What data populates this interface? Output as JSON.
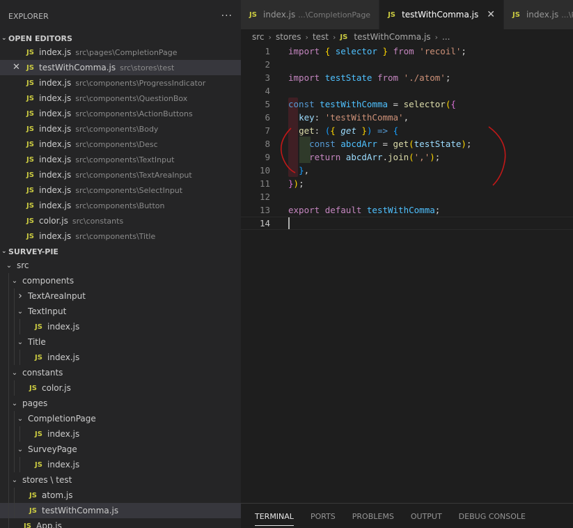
{
  "explorer": {
    "title": "EXPLORER",
    "more": "···"
  },
  "open_editors": {
    "title": "OPEN EDITORS",
    "items": [
      {
        "name": "index.js",
        "path": "src\\pages\\CompletionPage"
      },
      {
        "name": "testWithComma.js",
        "path": "src\\stores\\test",
        "active": true
      },
      {
        "name": "index.js",
        "path": "src\\components\\ProgressIndicator"
      },
      {
        "name": "index.js",
        "path": "src\\components\\QuestionBox"
      },
      {
        "name": "index.js",
        "path": "src\\components\\ActionButtons"
      },
      {
        "name": "index.js",
        "path": "src\\components\\Body"
      },
      {
        "name": "index.js",
        "path": "src\\components\\Desc"
      },
      {
        "name": "index.js",
        "path": "src\\components\\TextInput"
      },
      {
        "name": "index.js",
        "path": "src\\components\\TextAreaInput"
      },
      {
        "name": "index.js",
        "path": "src\\components\\SelectInput"
      },
      {
        "name": "index.js",
        "path": "src\\components\\Button"
      },
      {
        "name": "color.js",
        "path": "src\\constants"
      },
      {
        "name": "index.js",
        "path": "src\\components\\Title"
      }
    ]
  },
  "project": {
    "title": "SURVEY-PIE",
    "tree": [
      {
        "label": "src",
        "type": "folder",
        "level": 0
      },
      {
        "label": "components",
        "type": "folder",
        "level": 1
      },
      {
        "label": "TextAreaInput",
        "type": "folder-collapsed",
        "level": 2
      },
      {
        "label": "TextInput",
        "type": "folder",
        "level": 2
      },
      {
        "label": "index.js",
        "type": "file",
        "level": 3
      },
      {
        "label": "Title",
        "type": "folder",
        "level": 2
      },
      {
        "label": "index.js",
        "type": "file",
        "level": 3
      },
      {
        "label": "constants",
        "type": "folder",
        "level": 1
      },
      {
        "label": "color.js",
        "type": "file",
        "level": 2
      },
      {
        "label": "pages",
        "type": "folder",
        "level": 1
      },
      {
        "label": "CompletionPage",
        "type": "folder",
        "level": 2
      },
      {
        "label": "index.js",
        "type": "file",
        "level": 3
      },
      {
        "label": "SurveyPage",
        "type": "folder",
        "level": 2
      },
      {
        "label": "index.js",
        "type": "file",
        "level": 3
      },
      {
        "label": "stores \\ test",
        "type": "folder",
        "level": 1
      },
      {
        "label": "atom.js",
        "type": "file",
        "level": 2
      },
      {
        "label": "testWithComma.js",
        "type": "file",
        "level": 2,
        "active": true
      },
      {
        "label": "App.js",
        "type": "file",
        "level": 1
      }
    ]
  },
  "tabs": [
    {
      "name": "index.js",
      "desc": "...\\CompletionPage",
      "active": false
    },
    {
      "name": "testWithComma.js",
      "desc": "",
      "active": true,
      "close": "✕"
    },
    {
      "name": "index.js",
      "desc": "...\\Pr",
      "active": false
    }
  ],
  "js_badge": "JS",
  "breadcrumb": [
    "src",
    "stores",
    "test",
    "testWithComma.js",
    "..."
  ],
  "editor": {
    "current_line": 14,
    "lines": [
      {
        "n": 1,
        "tokens": [
          [
            "kw",
            "import"
          ],
          [
            "plain",
            " "
          ],
          [
            "br3",
            "{"
          ],
          [
            "plain",
            " "
          ],
          [
            "var",
            "selector"
          ],
          [
            "plain",
            " "
          ],
          [
            "br3",
            "}"
          ],
          [
            "plain",
            " "
          ],
          [
            "kw",
            "from"
          ],
          [
            "plain",
            " "
          ],
          [
            "str",
            "'recoil'"
          ],
          [
            "plain",
            ";"
          ]
        ]
      },
      {
        "n": 2,
        "tokens": []
      },
      {
        "n": 3,
        "tokens": [
          [
            "kw",
            "import"
          ],
          [
            "plain",
            " "
          ],
          [
            "var",
            "testState"
          ],
          [
            "plain",
            " "
          ],
          [
            "kw",
            "from"
          ],
          [
            "plain",
            " "
          ],
          [
            "str",
            "'./atom'"
          ],
          [
            "plain",
            ";"
          ]
        ]
      },
      {
        "n": 4,
        "tokens": []
      },
      {
        "n": 5,
        "tokens": [
          [
            "kw2",
            "const"
          ],
          [
            "plain",
            " "
          ],
          [
            "var",
            "testWithComma"
          ],
          [
            "plain",
            " = "
          ],
          [
            "fn",
            "selector"
          ],
          [
            "br3",
            "("
          ],
          [
            "br1",
            "{"
          ]
        ]
      },
      {
        "n": 6,
        "tokens": [
          [
            "plain",
            "  "
          ],
          [
            "prop",
            "key"
          ],
          [
            "plain",
            ": "
          ],
          [
            "str",
            "'testWithComma'"
          ],
          [
            "plain",
            ","
          ]
        ]
      },
      {
        "n": 7,
        "tokens": [
          [
            "plain",
            "  "
          ],
          [
            "fn",
            "get"
          ],
          [
            "plain",
            ": "
          ],
          [
            "br2",
            "("
          ],
          [
            "br3",
            "{"
          ],
          [
            "plain",
            " "
          ],
          [
            "prop ital",
            "get"
          ],
          [
            "plain",
            " "
          ],
          [
            "br3",
            "}"
          ],
          [
            "br2",
            ")"
          ],
          [
            "plain",
            " "
          ],
          [
            "kw2",
            "=>"
          ],
          [
            "plain",
            " "
          ],
          [
            "br2",
            "{"
          ]
        ]
      },
      {
        "n": 8,
        "tokens": [
          [
            "plain",
            "    "
          ],
          [
            "kw2",
            "const"
          ],
          [
            "plain",
            " "
          ],
          [
            "var",
            "abcdArr"
          ],
          [
            "plain",
            " = "
          ],
          [
            "fn",
            "get"
          ],
          [
            "br3",
            "("
          ],
          [
            "prop",
            "testState"
          ],
          [
            "br3",
            ")"
          ],
          [
            "plain",
            ";"
          ]
        ]
      },
      {
        "n": 9,
        "tokens": [
          [
            "plain",
            "    "
          ],
          [
            "kw",
            "return"
          ],
          [
            "plain",
            " "
          ],
          [
            "prop",
            "abcdArr"
          ],
          [
            "plain",
            "."
          ],
          [
            "fn",
            "join"
          ],
          [
            "br3",
            "("
          ],
          [
            "str",
            "','"
          ],
          [
            "br3",
            ")"
          ],
          [
            "plain",
            ";"
          ]
        ]
      },
      {
        "n": 10,
        "tokens": [
          [
            "plain",
            "  "
          ],
          [
            "br2",
            "}"
          ],
          [
            "plain",
            ","
          ]
        ]
      },
      {
        "n": 11,
        "tokens": [
          [
            "br1",
            "}"
          ],
          [
            "br3",
            ")"
          ],
          [
            "plain",
            ";"
          ]
        ]
      },
      {
        "n": 12,
        "tokens": []
      },
      {
        "n": 13,
        "tokens": [
          [
            "kw",
            "export"
          ],
          [
            "plain",
            " "
          ],
          [
            "kw",
            "default"
          ],
          [
            "plain",
            " "
          ],
          [
            "var",
            "testWithComma"
          ],
          [
            "plain",
            ";"
          ]
        ]
      },
      {
        "n": 14,
        "tokens": []
      }
    ]
  },
  "panel": {
    "tabs": [
      "TERMINAL",
      "PORTS",
      "PROBLEMS",
      "OUTPUT",
      "DEBUG CONSOLE"
    ],
    "active": 0
  },
  "colors": {
    "annotation": "#d01414",
    "js_badge": "#cbcb41",
    "active_row": "#37373d"
  }
}
